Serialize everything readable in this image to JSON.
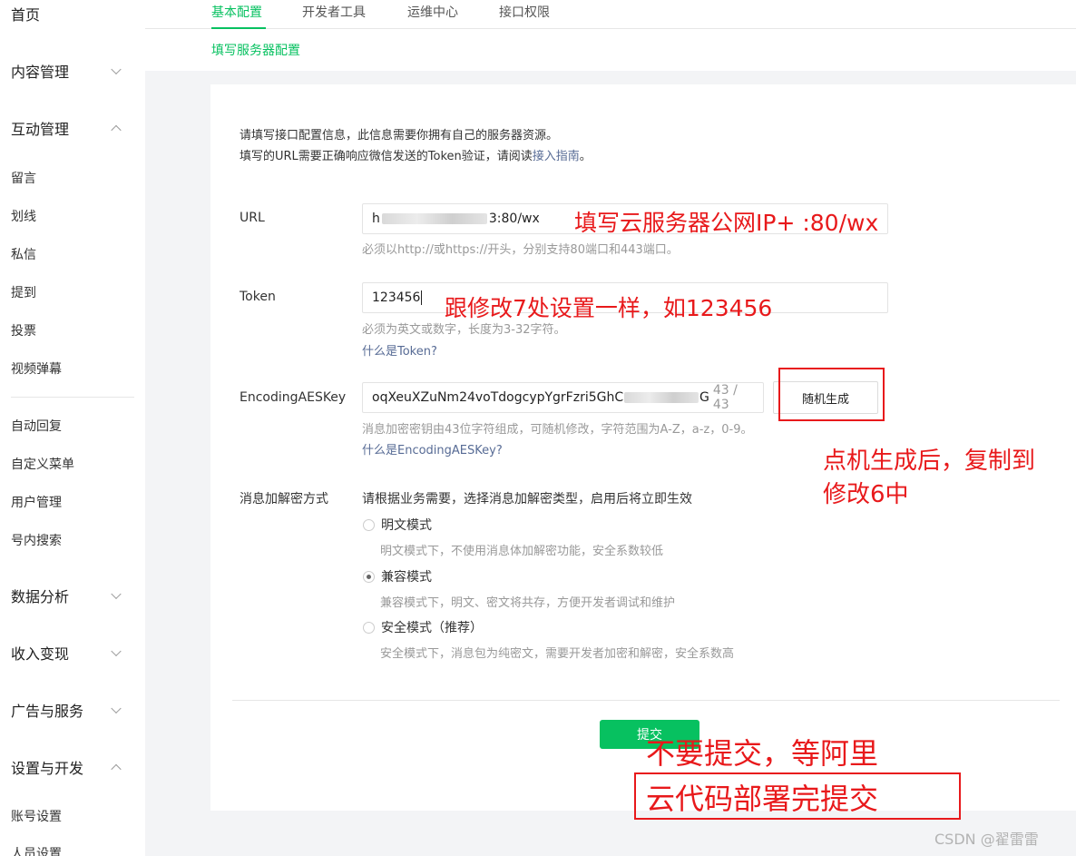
{
  "sidebar": {
    "home": "首页",
    "content": "内容管理",
    "interaction": "互动管理",
    "interaction_items": [
      "留言",
      "划线",
      "私信",
      "提到",
      "投票",
      "视频弹幕"
    ],
    "misc_items": [
      "自动回复",
      "自定义菜单",
      "用户管理",
      "号内搜索"
    ],
    "analytics": "数据分析",
    "monetize": "收入变现",
    "ads": "广告与服务",
    "settings": "设置与开发",
    "settings_items": [
      "账号设置",
      "人员设置"
    ]
  },
  "tabs": {
    "items": [
      "基本配置",
      "开发者工具",
      "运维中心",
      "接口权限"
    ],
    "active_index": 0
  },
  "breadcrumb": "填写服务器配置",
  "intro": {
    "line1": "请填写接口配置信息，此信息需要你拥有自己的服务器资源。",
    "line2_prefix": "填写的URL需要正确响应微信发送的Token验证，请阅读",
    "line2_link": "接入指南",
    "line2_suffix": "。"
  },
  "form": {
    "url": {
      "label": "URL",
      "value_prefix": "h",
      "value_suffix": "3:80/wx",
      "hint": "必须以http://或https://开头，分别支持80端口和443端口。"
    },
    "token": {
      "label": "Token",
      "value": "123456",
      "hint": "必须为英文或数字，长度为3-32字符。",
      "link": "什么是Token?"
    },
    "aes": {
      "label": "EncodingAESKey",
      "value": "oqXeuXZuNm24voTdogcypYgrFzri5GhC",
      "value_tail": "G",
      "counter": "43 / 43",
      "generate_button": "随机生成",
      "hint": "消息加密密钥由43位字符组成，可随机修改，字符范围为A-Z，a-z，0-9。",
      "link": "什么是EncodingAESKey?"
    },
    "encrypt": {
      "label": "消息加解密方式",
      "prompt": "请根据业务需要，选择消息加解密类型，启用后将立即生效",
      "options": [
        {
          "label": "明文模式",
          "desc": "明文模式下，不使用消息体加解密功能，安全系数较低",
          "checked": false
        },
        {
          "label": "兼容模式",
          "desc": "兼容模式下，明文、密文将共存，方便开发者调试和维护",
          "checked": true
        },
        {
          "label": "安全模式（推荐）",
          "desc": "安全模式下，消息包为纯密文，需要开发者加密和解密，安全系数高",
          "checked": false
        }
      ]
    },
    "submit": "提交"
  },
  "annotations": {
    "url_note": "填写云服务器公网IP+ :80/wx",
    "token_note": "跟修改7处设置一样，如123456",
    "gen_note_line1": "点机生成后，复制到",
    "gen_note_line2": "修改6中",
    "submit_note_line1": "不要提交，等阿里",
    "submit_note_line2": "云代码部署完提交",
    "color": "#e8191b"
  },
  "watermark": "CSDN @翟雷雷",
  "colors": {
    "accent": "#07c160",
    "link": "#576b95"
  }
}
